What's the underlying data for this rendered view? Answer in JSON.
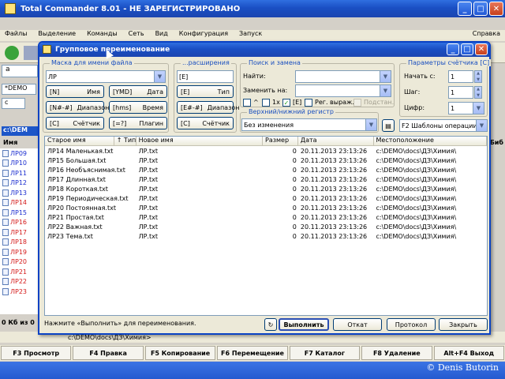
{
  "main": {
    "title": "Total Commander 8.01 - НЕ ЗАРЕГИСТРИРОВАНО",
    "menu": [
      "Файлы",
      "Выделение",
      "Команды",
      "Сеть",
      "Вид",
      "Конфигурация",
      "Запуск"
    ],
    "menu_right": "Справка",
    "drive": "a",
    "drive_c": "c",
    "path_short": "*DEMO",
    "path_panel": "c:\\DEM",
    "col_name": "Имя",
    "col_right": "Биб",
    "left_files": [
      {
        "name": "ЛР09",
        "color": "blue"
      },
      {
        "name": "ЛР10",
        "color": "blue"
      },
      {
        "name": "ЛР11",
        "color": "blue"
      },
      {
        "name": "ЛР12",
        "color": "blue"
      },
      {
        "name": "ЛР13",
        "color": "blue"
      },
      {
        "name": "ЛР14",
        "color": "red"
      },
      {
        "name": "ЛР15",
        "color": "blue"
      },
      {
        "name": "ЛР16",
        "color": "red"
      },
      {
        "name": "ЛР17",
        "color": "red"
      },
      {
        "name": "ЛР18",
        "color": "red"
      },
      {
        "name": "ЛР19",
        "color": "red"
      },
      {
        "name": "ЛР20",
        "color": "red"
      },
      {
        "name": "ЛР21",
        "color": "red"
      },
      {
        "name": "ЛР22",
        "color": "red"
      },
      {
        "name": "ЛР23",
        "color": "red"
      }
    ],
    "left_status": "0 Кб из 0",
    "cmd_path": "c:\\DEMO\\docs\\ДЗ\\Химия>",
    "fkeys": [
      "F3 Просмотр",
      "F4 Правка",
      "F5 Копирование",
      "F6 Перемещение",
      "F7 Каталог",
      "F8 Удаление",
      "Alt+F4 Выход"
    ],
    "copyright": "© Denis Butorin"
  },
  "dialog": {
    "title": "Групповое переименование",
    "mask_group": "Маска для имени файла",
    "mask_value": "ЛР",
    "ext_group": "...расширения",
    "ext_value": "[E]",
    "search_group": "Поиск и замена",
    "find_label": "Найти:",
    "replace_label": "Заменить на:",
    "counter_group": "Параметры счётчика [C]",
    "start_label": "Начать с:",
    "start_value": "1",
    "step_label": "Шаг:",
    "step_value": "1",
    "digits_label": "Цифр:",
    "digits_value": "1",
    "mask_buttons": [
      {
        "key": "[N]",
        "label": "Имя"
      },
      {
        "key": "[YMD]",
        "label": "Дата"
      },
      {
        "key": "[N#-#]",
        "label": "Диапазон"
      },
      {
        "key": "[hms]",
        "label": "Время"
      },
      {
        "key": "[C]",
        "label": "Счётчик"
      },
      {
        "key": "[=?]",
        "label": "Плагин"
      }
    ],
    "ext_buttons": [
      {
        "key": "[E]",
        "label": "Тип"
      },
      {
        "key": "[E#-#]",
        "label": "Диапазон"
      },
      {
        "key": "[C]",
        "label": "Счётчик"
      }
    ],
    "chk_caret": "^",
    "chk_1x": "1x",
    "chk_e": "[E]",
    "chk_regex": "Рег. выраж.",
    "chk_subst": "Подстан.",
    "case_group": "Верхний/нижний регистр",
    "case_value": "Без изменения",
    "f2_value": "F2 Шаблоны операции",
    "columns": [
      "Старое имя",
      "↑ Тип",
      "Новое имя",
      "Размер",
      "Дата",
      "Местоположение"
    ],
    "files": [
      {
        "old": "ЛР14 Маленькая.txt",
        "new": "ЛР.txt",
        "size": "0",
        "date": "20.11.2013 23:13:26",
        "loc": "c:\\DEMO\\docs\\ДЗ\\Химия\\"
      },
      {
        "old": "ЛР15 Большая.txt",
        "new": "ЛР.txt",
        "size": "0",
        "date": "20.11.2013 23:13:26",
        "loc": "c:\\DEMO\\docs\\ДЗ\\Химия\\"
      },
      {
        "old": "ЛР16 Необъяснимая.txt",
        "new": "ЛР.txt",
        "size": "0",
        "date": "20.11.2013 23:13:26",
        "loc": "c:\\DEMO\\docs\\ДЗ\\Химия\\"
      },
      {
        "old": "ЛР17 Длинная.txt",
        "new": "ЛР.txt",
        "size": "0",
        "date": "20.11.2013 23:13:26",
        "loc": "c:\\DEMO\\docs\\ДЗ\\Химия\\"
      },
      {
        "old": "ЛР18 Короткая.txt",
        "new": "ЛР.txt",
        "size": "0",
        "date": "20.11.2013 23:13:26",
        "loc": "c:\\DEMO\\docs\\ДЗ\\Химия\\"
      },
      {
        "old": "ЛР19 Периодическая.txt",
        "new": "ЛР.txt",
        "size": "0",
        "date": "20.11.2013 23:13:26",
        "loc": "c:\\DEMO\\docs\\ДЗ\\Химия\\"
      },
      {
        "old": "ЛР20 Постоянная.txt",
        "new": "ЛР.txt",
        "size": "0",
        "date": "20.11.2013 23:13:26",
        "loc": "c:\\DEMO\\docs\\ДЗ\\Химия\\"
      },
      {
        "old": "ЛР21 Простая.txt",
        "new": "ЛР.txt",
        "size": "0",
        "date": "20.11.2013 23:13:26",
        "loc": "c:\\DEMO\\docs\\ДЗ\\Химия\\"
      },
      {
        "old": "ЛР22 Важная.txt",
        "new": "ЛР.txt",
        "size": "0",
        "date": "20.11.2013 23:13:26",
        "loc": "c:\\DEMO\\docs\\ДЗ\\Химия\\"
      },
      {
        "old": "ЛР23 Тема.txt",
        "new": "ЛР.txt",
        "size": "0",
        "date": "20.11.2013 23:13:26",
        "loc": "c:\\DEMO\\docs\\ДЗ\\Химия\\"
      }
    ],
    "status": "Нажмите «Выполнить» для переименования.",
    "buttons": {
      "run": "Выполнить",
      "undo": "Откат",
      "log": "Протокол",
      "close": "Закрыть"
    },
    "colors": {
      "accent": "#0a42c4",
      "legend": "#1a4fbf"
    }
  }
}
